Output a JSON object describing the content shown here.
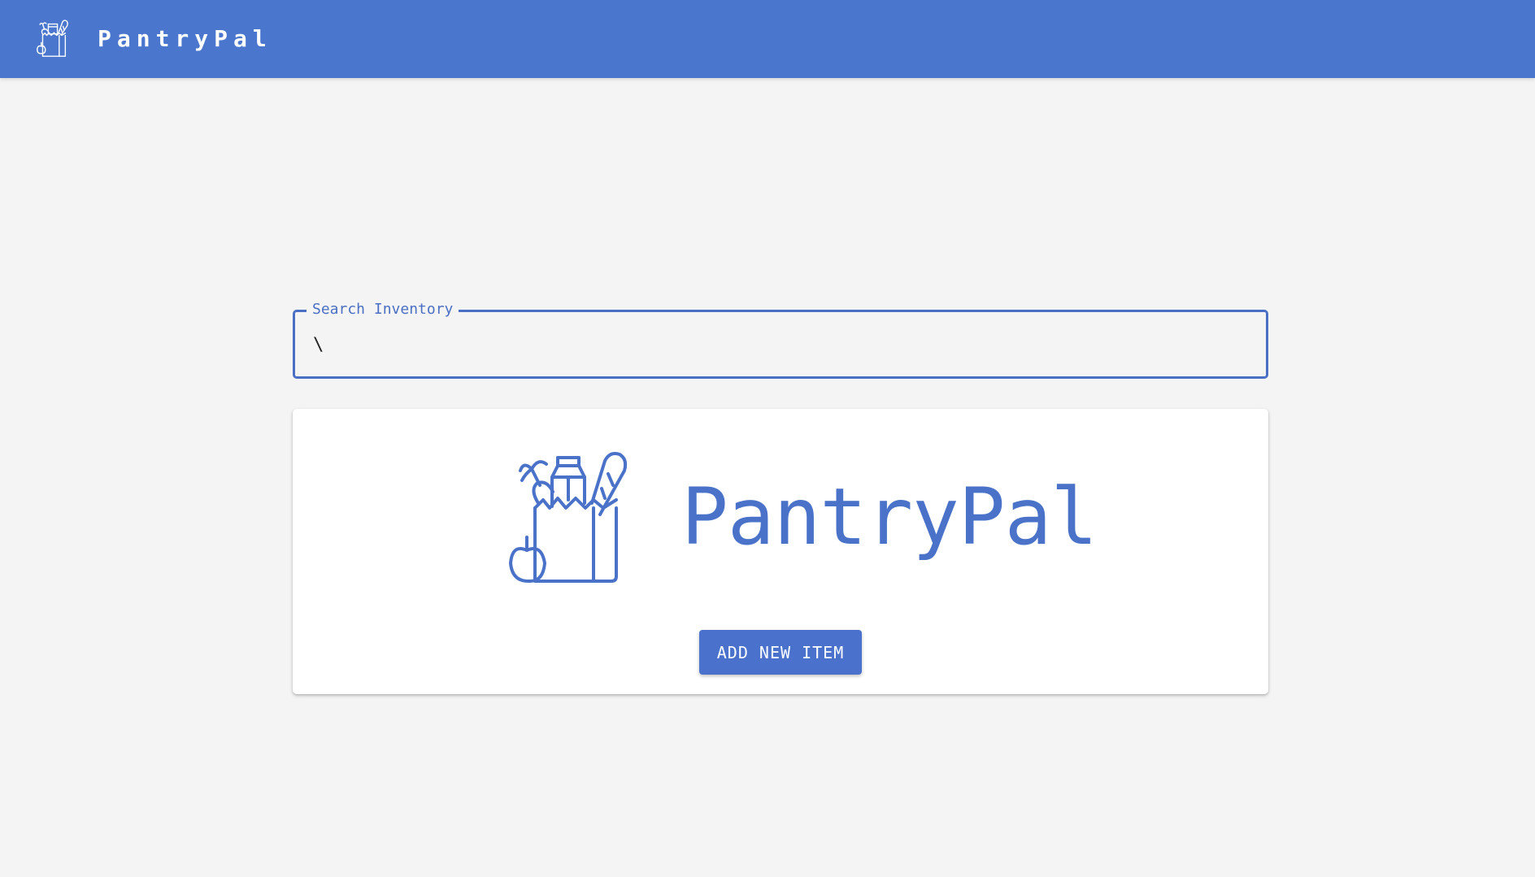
{
  "header": {
    "title": "PantryPal",
    "logo_icon": "grocery-bag-icon",
    "background_color": "#4a76cd"
  },
  "search": {
    "label": "Search Inventory",
    "value": "\\",
    "accent_color": "#4a6fc4"
  },
  "card": {
    "logo_icon": "grocery-bag-icon",
    "title": "PantryPal",
    "add_button_label": "ADD NEW ITEM",
    "accent_color": "#4a72c9"
  }
}
